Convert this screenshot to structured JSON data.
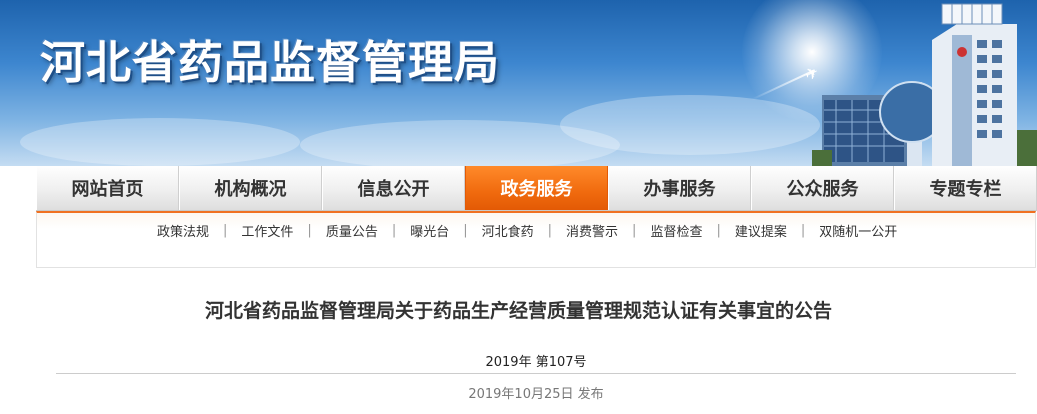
{
  "header": {
    "site_title": "河北省药品监督管理局"
  },
  "nav": {
    "items": [
      {
        "label": "网站首页"
      },
      {
        "label": "机构概况"
      },
      {
        "label": "信息公开"
      },
      {
        "label": "政务服务",
        "active": true
      },
      {
        "label": "办事服务"
      },
      {
        "label": "公众服务"
      },
      {
        "label": "专题专栏"
      }
    ],
    "active_color": "#f06a0e"
  },
  "subnav": {
    "items": [
      {
        "label": "政策法规"
      },
      {
        "label": "工作文件"
      },
      {
        "label": "质量公告"
      },
      {
        "label": "曝光台"
      },
      {
        "label": "河北食药"
      },
      {
        "label": "消费警示"
      },
      {
        "label": "监督检查"
      },
      {
        "label": "建议提案"
      },
      {
        "label": "双随机一公开"
      }
    ],
    "separator": "|"
  },
  "article": {
    "title": "河北省药品监督管理局关于药品生产经营质量管理规范认证有关事宜的公告",
    "doc_number": "2019年  第107号",
    "publish_date": "2019年10月25日  发布"
  }
}
